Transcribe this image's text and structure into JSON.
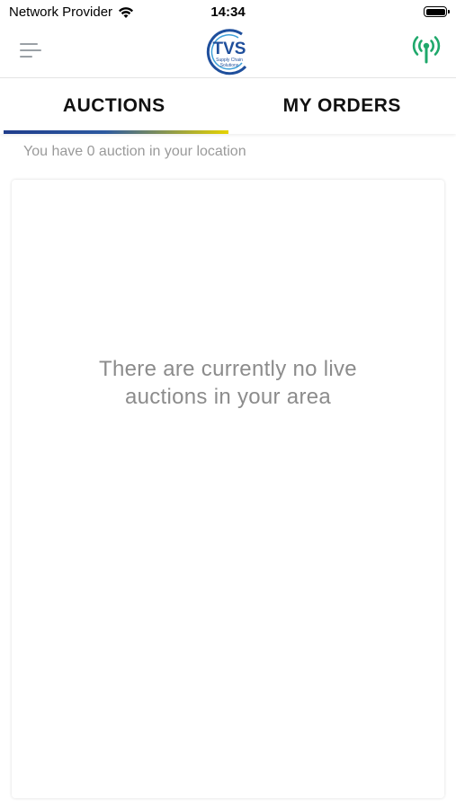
{
  "status_bar": {
    "carrier": "Network Provider",
    "time": "14:34"
  },
  "header": {
    "logo_text": "TVS",
    "logo_subtext_1": "Supply Chain",
    "logo_subtext_2": "Solutions",
    "colors": {
      "logo_blue": "#1f4f9c",
      "broadcast_green": "#1fa86b"
    }
  },
  "tabs": [
    {
      "label": "AUCTIONS",
      "active": true
    },
    {
      "label": "MY ORDERS",
      "active": false
    }
  ],
  "info_text": "You have 0 auction in your location",
  "empty_state": {
    "line1": "There are currently no live",
    "line2": "auctions in your area"
  }
}
